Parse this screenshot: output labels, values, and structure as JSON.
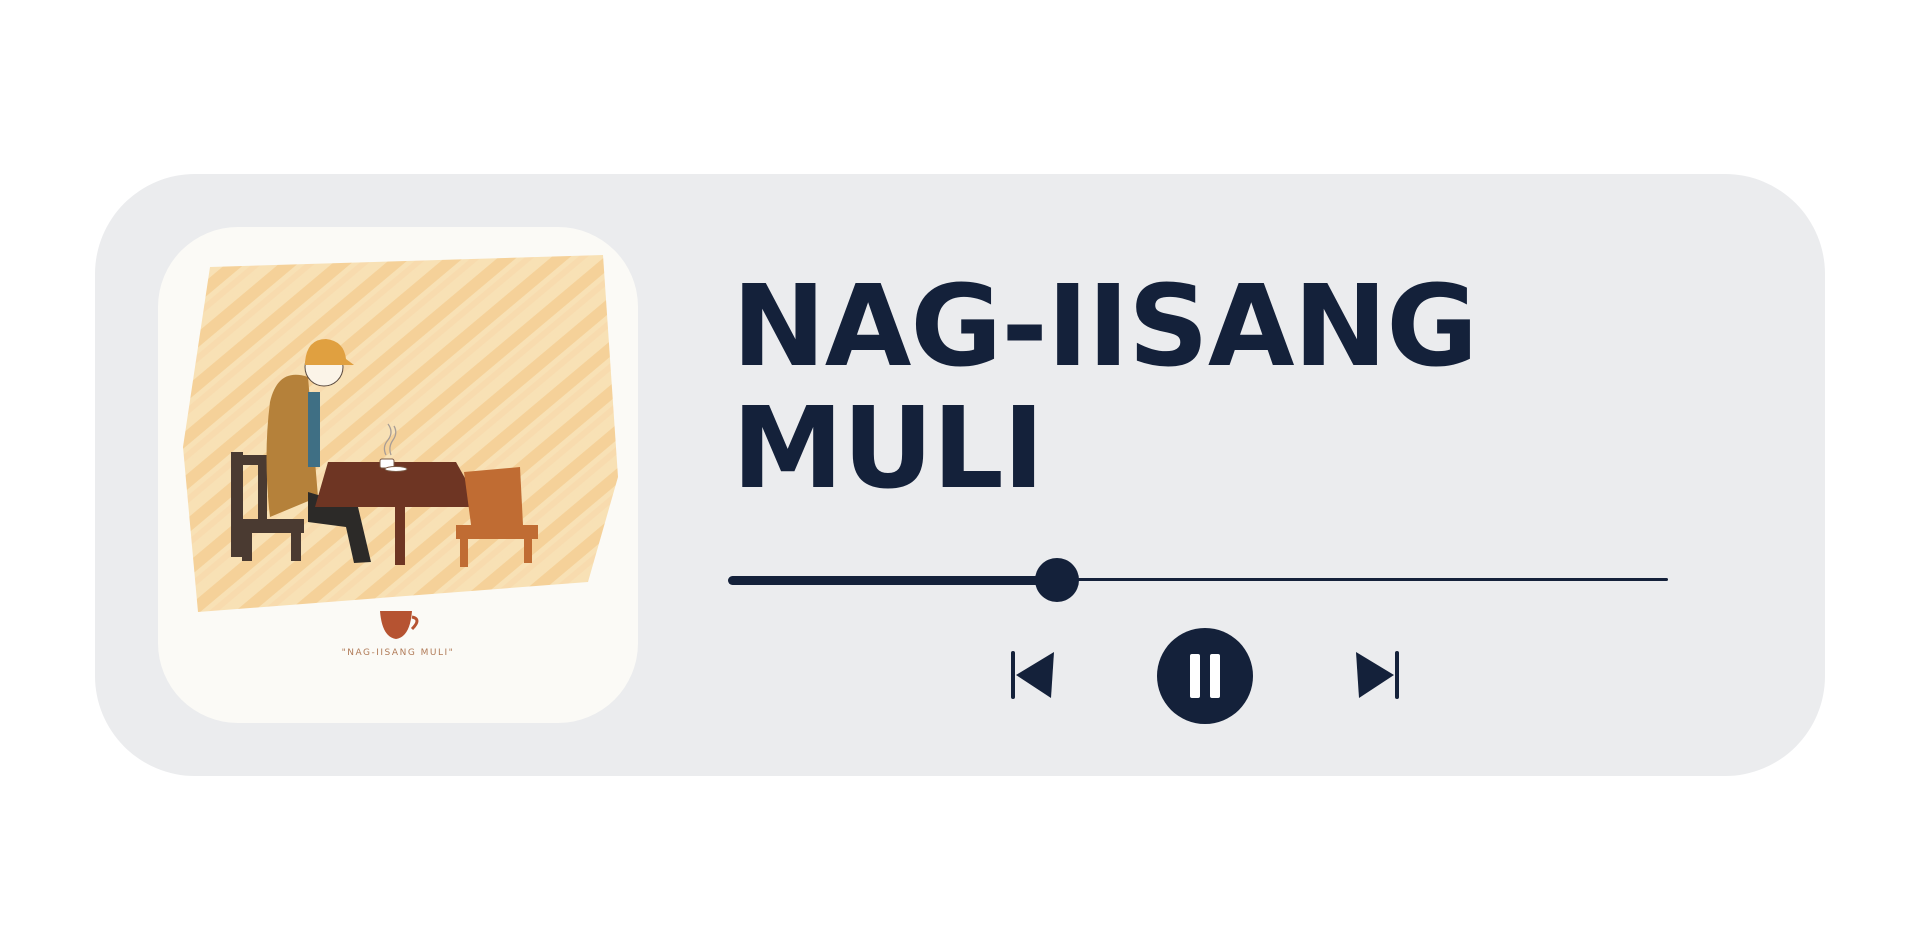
{
  "track": {
    "title": "NAG-IISANG MULI",
    "cover_caption": "\"NAG-IISANG MULI\"",
    "progress_fraction": 0.35,
    "is_playing": true
  },
  "controls": {
    "previous_icon": "skip-previous-icon",
    "pause_icon": "pause-icon",
    "next_icon": "skip-next-icon"
  },
  "colors": {
    "accent": "#14213a",
    "card_background": "#ebecee",
    "page_background": "#ffffff"
  }
}
